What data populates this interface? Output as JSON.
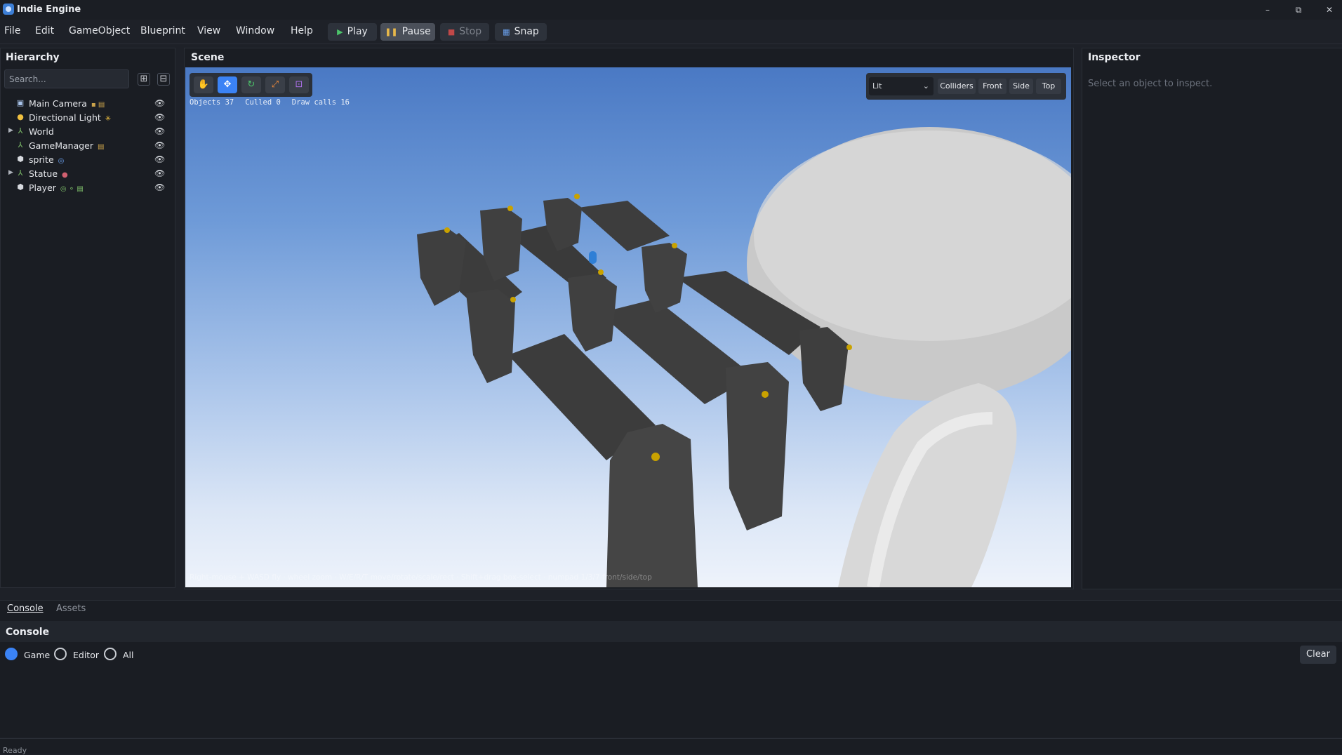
{
  "app": {
    "title": "Indie Engine"
  },
  "window_controls": [
    "–",
    "⧉",
    "✕"
  ],
  "menu": [
    "File",
    "Edit",
    "GameObject",
    "Blueprint",
    "View",
    "Window",
    "Help"
  ],
  "toolbar": {
    "play": "Play",
    "pause": "Pause",
    "stop": "Stop",
    "snap": "Snap"
  },
  "hierarchy": {
    "title": "Hierarchy",
    "search_placeholder": "Search...",
    "expand_all": "⊞",
    "collapse_all": "⊟",
    "items": [
      {
        "label": "Main Camera",
        "icon": "camera-icon",
        "expandable": false,
        "tags": "▪ ▤"
      },
      {
        "label": "Directional Light",
        "icon": "light-icon",
        "expandable": false,
        "tags": "✳"
      },
      {
        "label": "World",
        "icon": "transform-icon",
        "expandable": true,
        "tags": ""
      },
      {
        "label": "GameManager",
        "icon": "transform-icon",
        "expandable": false,
        "tags": "▤"
      },
      {
        "label": "sprite",
        "icon": "cube-icon",
        "expandable": false,
        "tags": "◎"
      },
      {
        "label": "Statue",
        "icon": "transform-icon",
        "expandable": true,
        "tags": "●"
      },
      {
        "label": "Player",
        "icon": "cube-icon",
        "expandable": false,
        "tags": "◎ ⚬ ▤"
      }
    ]
  },
  "scene": {
    "title": "Scene",
    "stats": {
      "objects": "Objects 37",
      "culled": "Culled 0",
      "draw_calls": "Draw calls 16"
    },
    "shading": "Lit",
    "view_buttons": [
      "Colliders",
      "Front",
      "Side",
      "Top"
    ],
    "hint": "Right-mouse + WASD fly · wheel zoom · W/E/R/T move/rotate/scale/rect · Shift+drag box-select · numpad 1/3/7 front/side/top"
  },
  "inspector": {
    "title": "Inspector",
    "empty_text": "Select an object to inspect."
  },
  "bottom_tabs": [
    "Console",
    "Assets"
  ],
  "console": {
    "title": "Console",
    "filters": [
      "Game",
      "Editor",
      "All"
    ],
    "selected_filter": "Game",
    "clear": "Clear"
  },
  "status": "Ready",
  "colors": {
    "accent": "#3b83f5",
    "bg": "#1e2128",
    "panel": "#1a1d23"
  }
}
